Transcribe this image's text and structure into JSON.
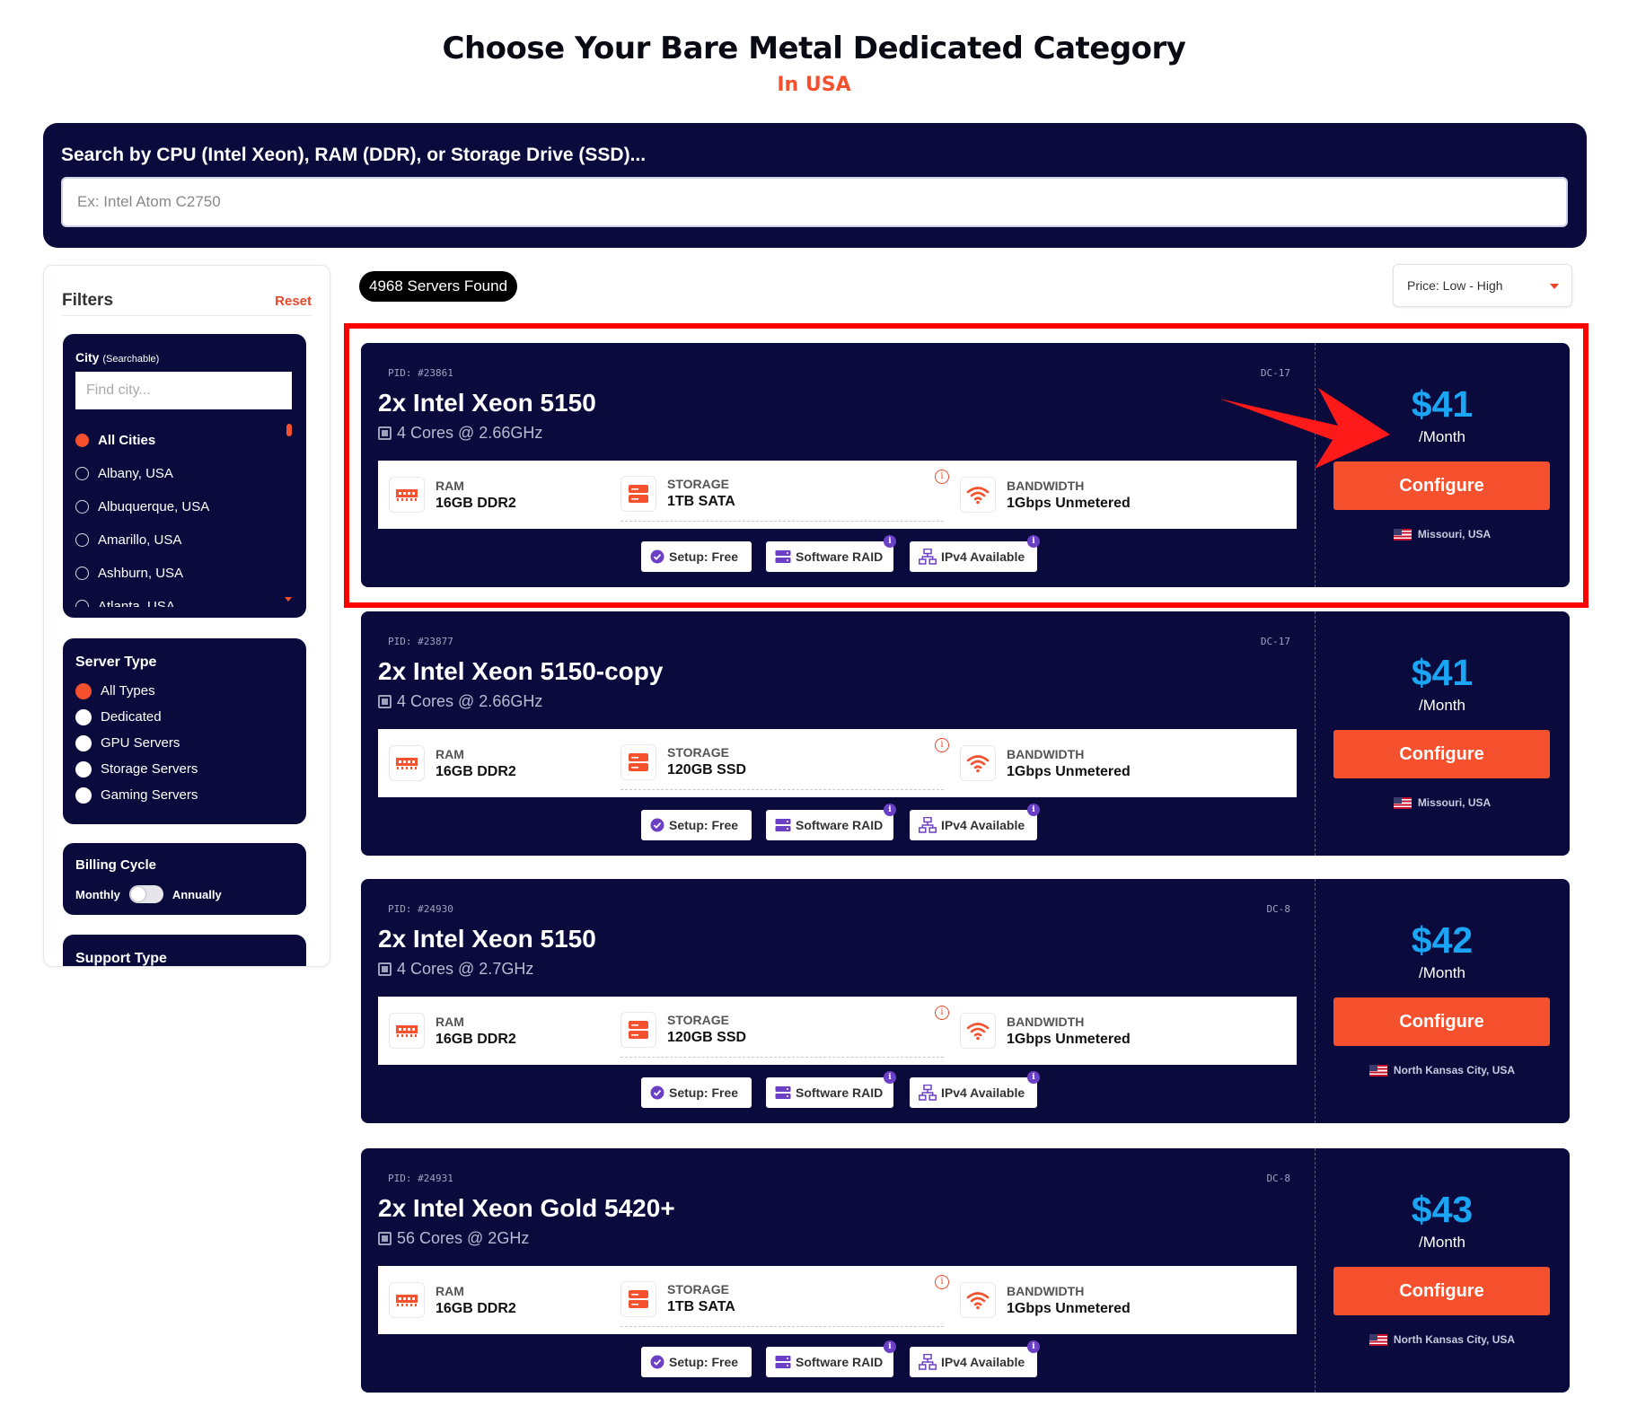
{
  "page": {
    "title": "Choose Your Bare Metal Dedicated Category",
    "subtitle": "In USA"
  },
  "search": {
    "label": "Search by CPU (Intel Xeon), RAM (DDR), or Storage Drive (SSD)...",
    "placeholder": "Ex: Intel Atom C2750",
    "value": ""
  },
  "filters": {
    "title": "Filters",
    "reset_label": "Reset",
    "city": {
      "title": "City",
      "title_note": "(Searchable)",
      "placeholder": "Find city...",
      "options": [
        "All Cities",
        "Albany, USA",
        "Albuquerque, USA",
        "Amarillo, USA",
        "Ashburn, USA",
        "Atlanta, USA"
      ],
      "selected": "All Cities"
    },
    "server_type": {
      "title": "Server Type",
      "options": [
        "All Types",
        "Dedicated",
        "GPU Servers",
        "Storage Servers",
        "Gaming Servers"
      ],
      "selected": "All Types"
    },
    "billing_cycle": {
      "title": "Billing Cycle",
      "left_label": "Monthly",
      "right_label": "Annually",
      "annual_enabled": false
    },
    "support_type": {
      "title": "Support Type"
    }
  },
  "results": {
    "count_label": "4968 Servers Found",
    "sort_label": "Price: Low - High"
  },
  "labels": {
    "ram": "RAM",
    "storage": "STORAGE",
    "bandwidth": "BANDWIDTH",
    "per_month": "/Month",
    "configure": "Configure",
    "setup": "Setup: Free",
    "raid": "Software RAID",
    "ipv4": "IPv4 Available",
    "info": "i"
  },
  "servers": [
    {
      "pid": "PID: #23861",
      "dc": "DC-17",
      "name": "2x Intel Xeon 5150",
      "cores": "4 Cores @ 2.66GHz",
      "ram": "16GB DDR2",
      "storage": "1TB SATA",
      "bandwidth": "1Gbps Unmetered",
      "price": "$41",
      "location": "Missouri, USA"
    },
    {
      "pid": "PID: #23877",
      "dc": "DC-17",
      "name": "2x Intel Xeon 5150-copy",
      "cores": "4 Cores @ 2.66GHz",
      "ram": "16GB DDR2",
      "storage": "120GB SSD",
      "bandwidth": "1Gbps Unmetered",
      "price": "$41",
      "location": "Missouri, USA"
    },
    {
      "pid": "PID: #24930",
      "dc": "DC-8",
      "name": "2x Intel Xeon 5150",
      "cores": "4 Cores @ 2.7GHz",
      "ram": "16GB DDR2",
      "storage": "120GB SSD",
      "bandwidth": "1Gbps Unmetered",
      "price": "$42",
      "location": "North Kansas City, USA"
    },
    {
      "pid": "PID: #24931",
      "dc": "DC-8",
      "name": "2x Intel Xeon Gold 5420+",
      "cores": "56 Cores @ 2GHz",
      "ram": "16GB DDR2",
      "storage": "1TB SATA",
      "bandwidth": "1Gbps Unmetered",
      "price": "$43",
      "location": "North Kansas City, USA"
    }
  ],
  "colors": {
    "navy": "#0a0a3c",
    "accent": "#f5512f",
    "price_blue": "#1ba6f5",
    "highlight_red": "#ff0000"
  },
  "icons": {
    "ram": "ram-chip-icon",
    "storage": "hard-drive-icon",
    "bandwidth": "wifi-icon",
    "setup": "check-circle-icon",
    "raid": "server-stack-icon",
    "ipv4": "network-icon",
    "cpu": "cpu-chip-icon",
    "location": "us-flag-icon"
  }
}
